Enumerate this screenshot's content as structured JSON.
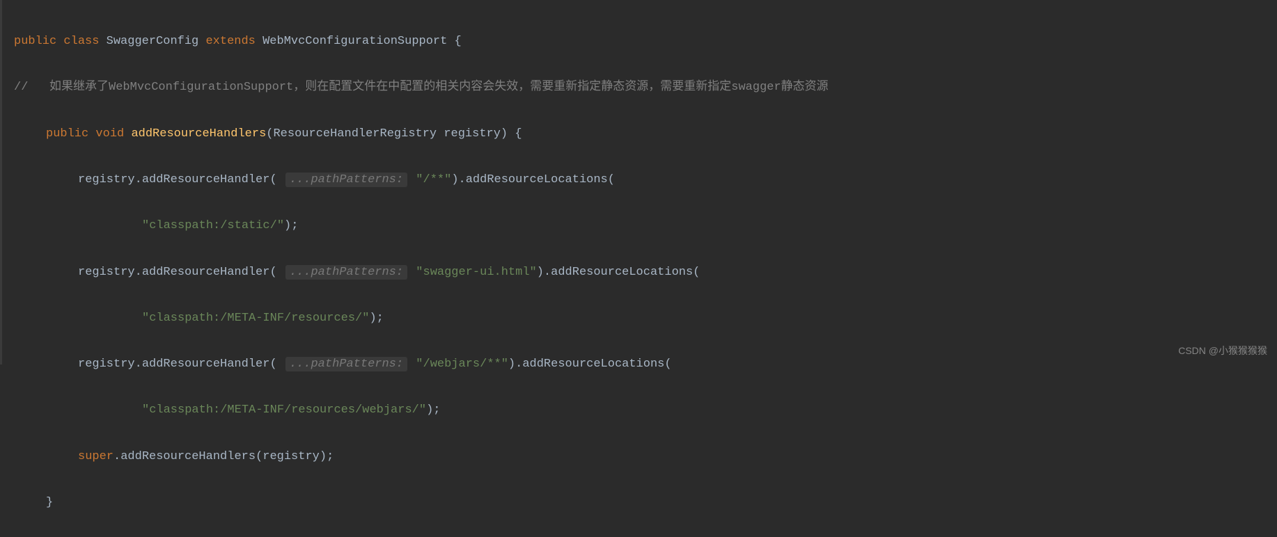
{
  "code": {
    "line1": {
      "kw_public": "public",
      "kw_class": "class",
      "class_name": "SwaggerConfig",
      "kw_extends": "extends",
      "super_class": "WebMvcConfigurationSupport",
      "brace": "{"
    },
    "line2": {
      "prefix": "//",
      "comment": "如果继承了WebMvcConfigurationSupport，则在配置文件在中配置的相关内容会失效，需要重新指定静态资源，需要重新指定swagger静态资源"
    },
    "line3": {
      "kw_public": "public",
      "kw_void": "void",
      "method_name": "addResourceHandlers",
      "params": "(ResourceHandlerRegistry registry) {"
    },
    "line4": {
      "part1": "registry.addResourceHandler(",
      "hint": "...pathPatterns:",
      "str1": "\"/**\"",
      "part2": ").addResourceLocations("
    },
    "line5": {
      "str": "\"classpath:/static/\"",
      "end": ");"
    },
    "line6": {
      "part1": "registry.addResourceHandler(",
      "hint": "...pathPatterns:",
      "str1": "\"swagger-ui.html\"",
      "part2": ").addResourceLocations("
    },
    "line7": {
      "str": "\"classpath:/META-INF/resources/\"",
      "end": ");"
    },
    "line8": {
      "part1": "registry.addResourceHandler(",
      "hint": "...pathPatterns:",
      "str1": "\"/webjars/**\"",
      "part2": ").addResourceLocations("
    },
    "line9": {
      "str": "\"classpath:/META-INF/resources/webjars/\"",
      "end": ");"
    },
    "line10": {
      "kw_super": "super",
      "rest": ".addResourceHandlers(registry);"
    },
    "line11": {
      "brace": "}"
    }
  },
  "watermark": "CSDN @小猴猴猴猴"
}
